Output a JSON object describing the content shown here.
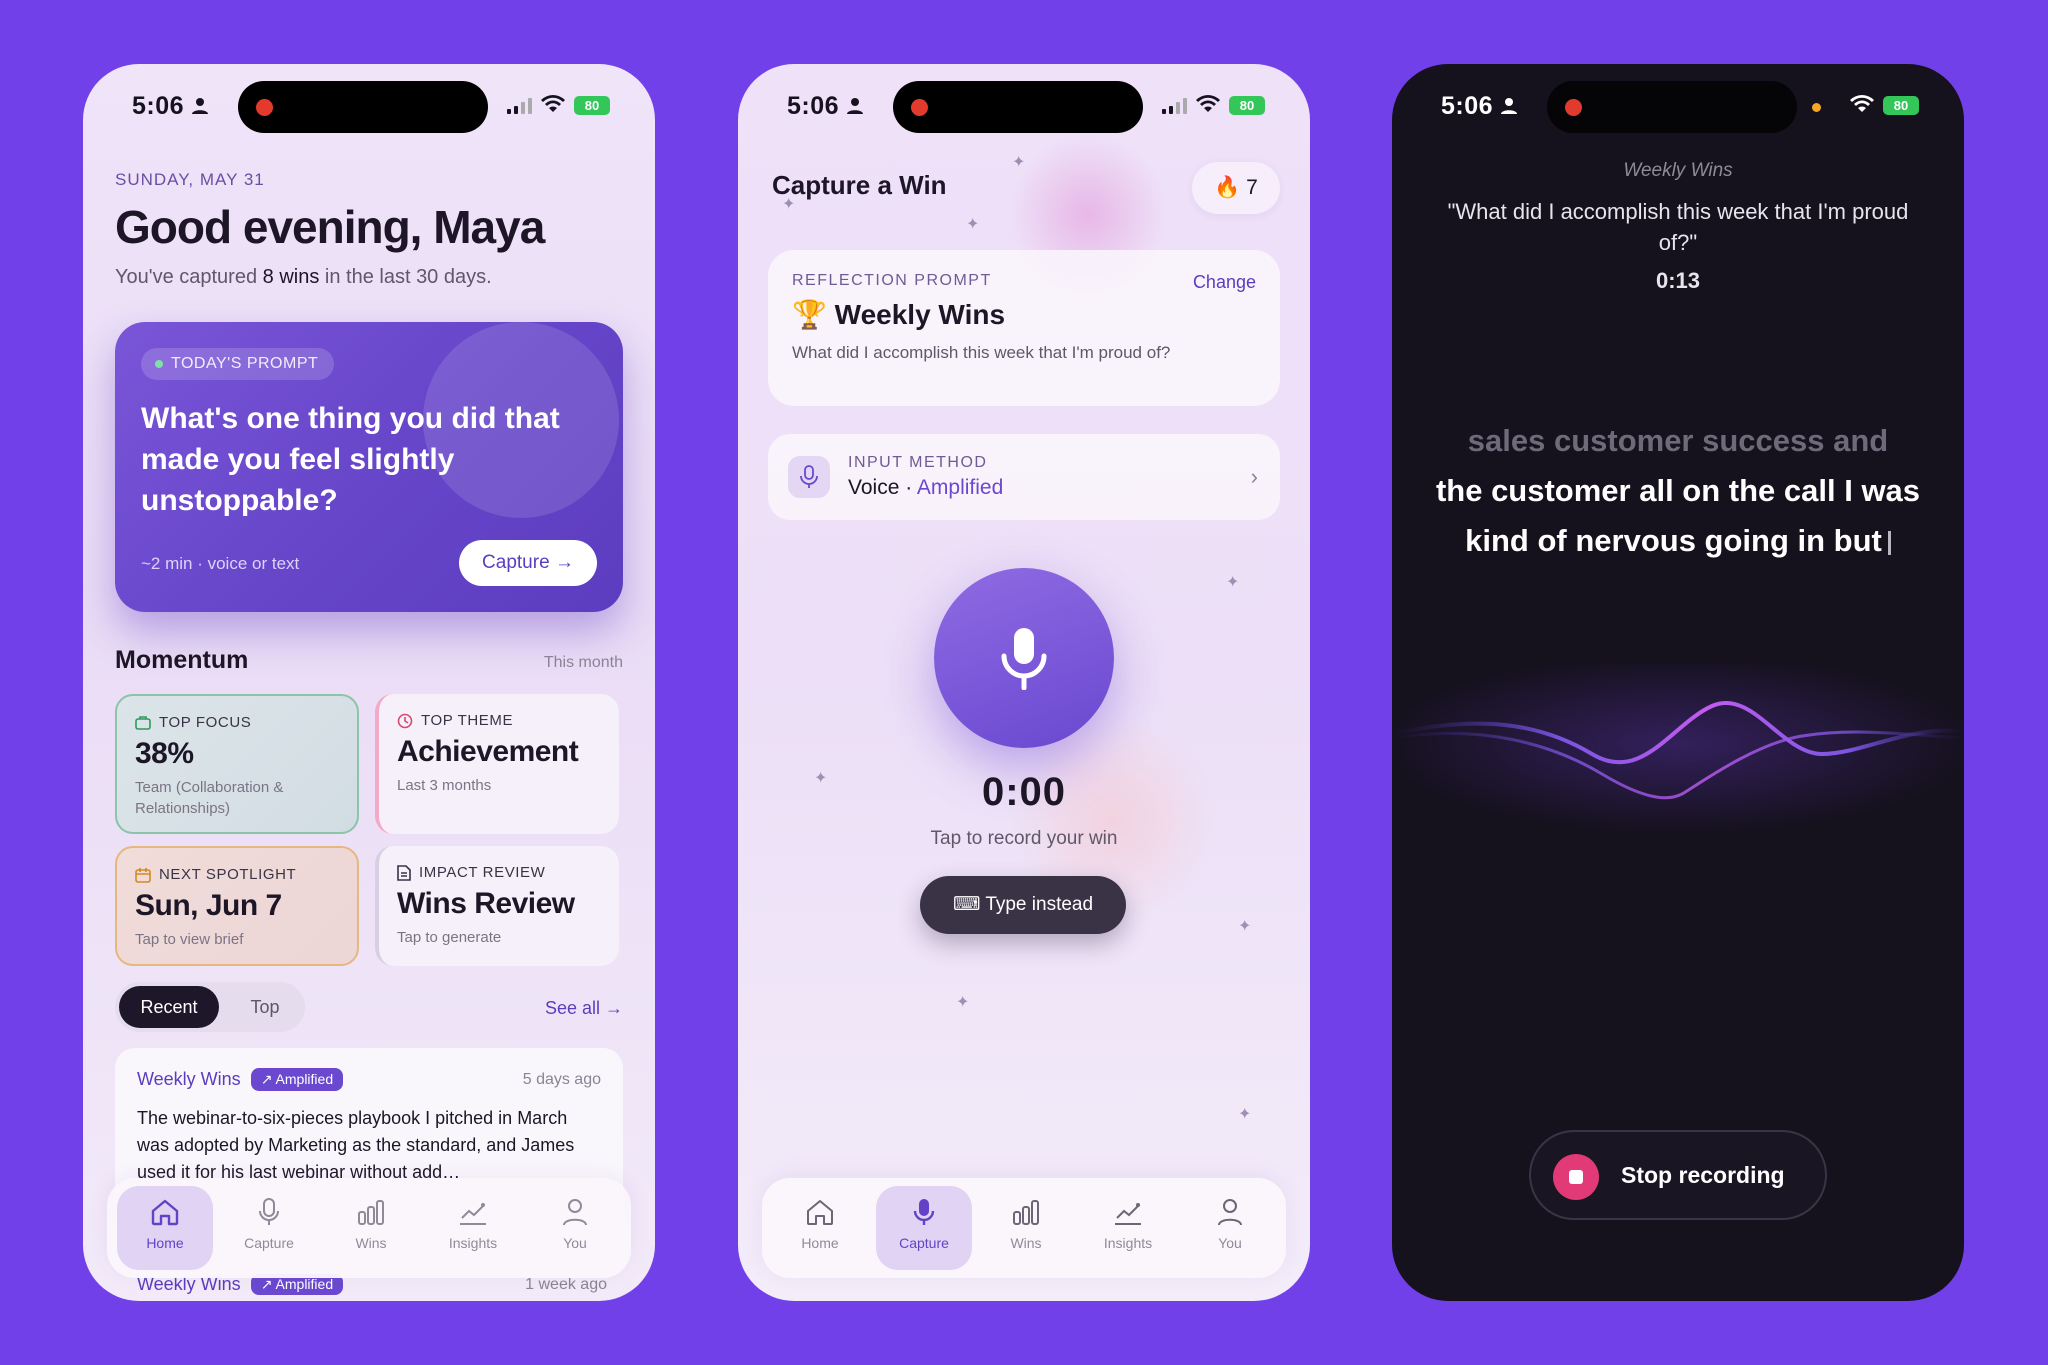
{
  "status": {
    "time": "5:06",
    "battery": "80"
  },
  "home": {
    "date": "SUNDAY, MAY 31",
    "greeting": "Good evening, Maya",
    "sub_prefix": "You've captured ",
    "sub_count": "8 wins",
    "sub_suffix": " in the last 30 days.",
    "prompt": {
      "chip": "TODAY'S PROMPT",
      "question": "What's one thing you did that made you feel slightly unstoppable?",
      "meta": "~2 min · voice or text",
      "button": "Capture"
    },
    "momentum": {
      "title": "Momentum",
      "period": "This month",
      "cards": [
        {
          "label": "TOP FOCUS",
          "value": "38%",
          "desc": "Team (Collaboration & Relationships)"
        },
        {
          "label": "TOP THEME",
          "value": "Achievement",
          "desc": "Last 3 months"
        },
        {
          "label": "NEXT SPOTLIGHT",
          "value": "Sun, Jun 7",
          "desc": "Tap to view brief"
        },
        {
          "label": "IMPACT REVIEW",
          "value": "Wins Review",
          "desc": "Tap to generate"
        }
      ]
    },
    "segments": {
      "recent": "Recent",
      "top": "Top"
    },
    "see_all": "See all →",
    "wins": [
      {
        "category": "Weekly Wins",
        "tag": "↗ Amplified",
        "ago": "5 days ago",
        "text": "The webinar-to-six-pieces playbook I pitched in March was adopted by Marketing as the standard, and James used it for his last webinar without add…"
      },
      {
        "category": "Weekly Wins",
        "tag": "↗ Amplified",
        "ago": "1 week ago"
      }
    ]
  },
  "tabs": [
    "Home",
    "Capture",
    "Wins",
    "Insights",
    "You"
  ],
  "capture": {
    "title": "Capture a Win",
    "streak_emoji": "🔥",
    "streak": "7",
    "reflection_label": "REFLECTION PROMPT",
    "change": "Change",
    "prompt_emoji": "🏆",
    "prompt_title": "Weekly Wins",
    "prompt_desc": "What did I accomplish this week that I'm proud of?",
    "input_label": "INPUT METHOD",
    "input_value": "Voice · ",
    "input_mode": "Amplified",
    "timer": "0:00",
    "hint": "Tap to record your win",
    "type_instead": "Type instead"
  },
  "recording": {
    "category": "Weekly Wins",
    "question": "\"What did I accomplish this week that I'm proud of?\"",
    "elapsed": "0:13",
    "transcript_faded": "sales customer success and",
    "transcript": "the customer all on the call I was kind of nervous going in but",
    "stop": "Stop recording"
  },
  "colors": {
    "accent": "#6a48d0",
    "record": "#e23a76",
    "background": "#7140e8"
  }
}
